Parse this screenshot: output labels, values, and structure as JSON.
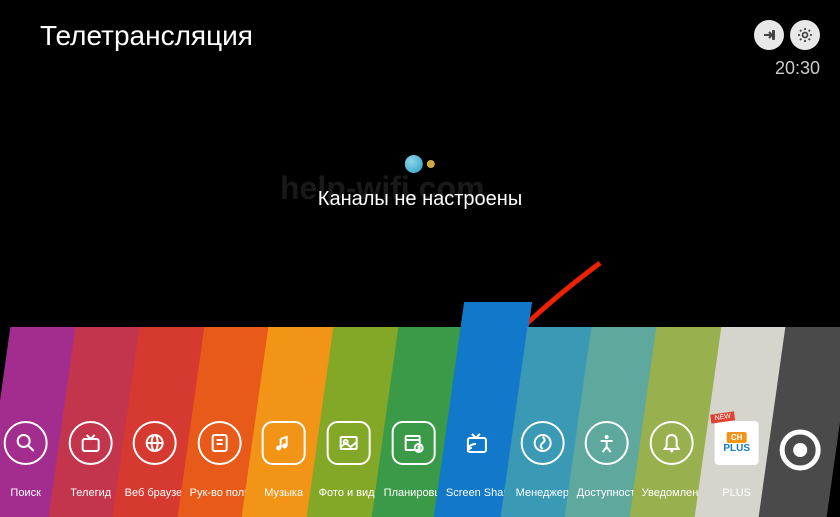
{
  "header": {
    "title": "Телетрансляция",
    "time": "20:30"
  },
  "status": {
    "message": "Каналы не настроены"
  },
  "watermark": "help-wifi.com",
  "tiles": [
    {
      "label": "Поиск",
      "color": "#a32c8f",
      "icon": "search"
    },
    {
      "label": "Телегид",
      "color": "#c2354c",
      "icon": "tvguide"
    },
    {
      "label": "Веб браузер",
      "color": "#d6392f",
      "icon": "web"
    },
    {
      "label": "Рук-во пользователя",
      "color": "#e85a1a",
      "icon": "guide"
    },
    {
      "label": "Музыка",
      "color": "#f29416",
      "icon": "music"
    },
    {
      "label": "Фото и видео",
      "color": "#83a828",
      "icon": "photo"
    },
    {
      "label": "Планировщик",
      "color": "#3a9a47",
      "icon": "schedule"
    },
    {
      "label": "Screen Share",
      "color": "#1278c9",
      "icon": "share",
      "selected": true
    },
    {
      "label": "Менеджер",
      "color": "#3a99b5",
      "icon": "manager"
    },
    {
      "label": "Доступность",
      "color": "#5fa89e",
      "icon": "access"
    },
    {
      "label": "Уведомления",
      "color": "#98b04e",
      "icon": "notify"
    },
    {
      "label": "PLUS",
      "color": "#d5d5ce",
      "icon": "plus"
    },
    {
      "label": "",
      "color": "#4a4a4a",
      "icon": "record"
    }
  ]
}
